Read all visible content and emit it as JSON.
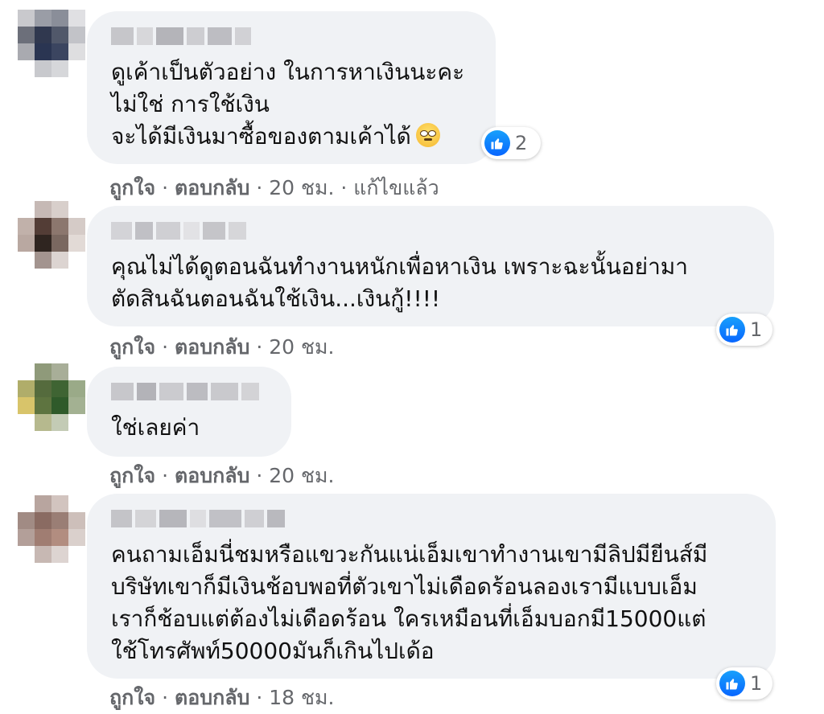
{
  "comments": [
    {
      "text": "ดูเค้าเป็นตัวอย่าง ในการหาเงินนะคะ\nไม่ใช่ การใช้เงิน\nจะได้มีเงินมาซื้อของตามเค้าได้",
      "emoji": "face-with-rolling-eyes-emoji",
      "reaction_count": "2",
      "like": "ถูกใจ",
      "reply": "ตอบกลับ",
      "time": "20 ชม.",
      "edited": "แก้ไขแล้ว"
    },
    {
      "text": "คุณไม่ได้ดูตอนฉันทำงานหนักเพื่อหาเงิน เพราะฉะนั้นอย่ามา\nตัดสินฉันตอนฉันใช้เงิน...เงินกู้!!!!",
      "reaction_count": "1",
      "like": "ถูกใจ",
      "reply": "ตอบกลับ",
      "time": "20 ชม."
    },
    {
      "text": "ใช่เลยค่า",
      "like": "ถูกใจ",
      "reply": "ตอบกลับ",
      "time": "20 ชม."
    },
    {
      "text": "คนถามเอ็มนี่ชมหรือแขวะกันแน่เอ็มเขาทำงานเขามีลิปมียีนส์มี\nบริษัทเขาก็มีเงินช้อบพอที่ตัวเขาไม่เดือดร้อนลองเรามีแบบเอ็ม\nเราก็ช้อบแต่ต้องไม่เดือดร้อน ใครเหมือนที่เอ็มบอกมี15000แต่\nใช้โทรศัพท์50000มันก็เกินไปเด้อ",
      "reaction_count": "1",
      "like": "ถูกใจ",
      "reply": "ตอบกลับ",
      "time": "18 ชม."
    }
  ],
  "separator": " · ",
  "colors": {
    "bubble": "#f0f2f5",
    "like_blue": "#0866ff",
    "meta_text": "#65676b"
  }
}
